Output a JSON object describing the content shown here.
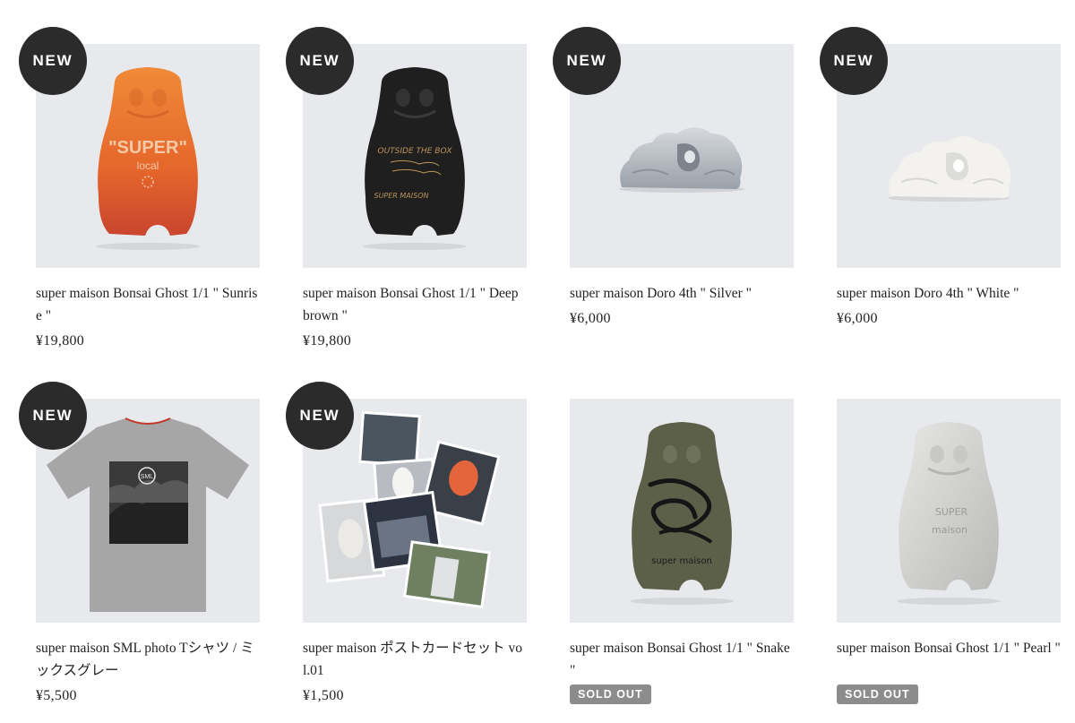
{
  "products": [
    {
      "title": "super maison Bonsai Ghost 1/1 \" Sunrise \"",
      "price": "¥19,800",
      "badge": "NEW",
      "image_icon": "orange-ghost-figure"
    },
    {
      "title": "super maison Bonsai Ghost 1/1 \" Deep brown \"",
      "price": "¥19,800",
      "badge": "NEW",
      "image_icon": "black-ghost-figure"
    },
    {
      "title": "super maison Doro 4th \" Silver \"",
      "price": "¥6,000",
      "badge": "NEW",
      "image_icon": "silver-doro-figure"
    },
    {
      "title": "super maison Doro 4th \" White \"",
      "price": "¥6,000",
      "badge": "NEW",
      "image_icon": "white-doro-figure"
    },
    {
      "title": "super maison SML photo Tシャツ / ミックスグレー",
      "price": "¥5,500",
      "badge": "NEW",
      "image_icon": "grey-tshirt"
    },
    {
      "title": "super maison ポストカードセット vol.01",
      "price": "¥1,500",
      "badge": "NEW",
      "image_icon": "postcard-set"
    },
    {
      "title": "super maison Bonsai Ghost 1/1 \" Snake \"",
      "status": "SOLD OUT",
      "image_icon": "snake-ghost-figure"
    },
    {
      "title": "super maison Bonsai Ghost 1/1 \" Pearl \"",
      "status": "SOLD OUT",
      "image_icon": "pearl-ghost-figure"
    }
  ],
  "figure_text": {
    "sunrise_word1": "\"SUPER\"",
    "sunrise_word2": "local",
    "deep_brown_word1": "OUTSIDE THE BOX",
    "deep_brown_word2": "SUPER MAISON",
    "snake_word": "super maison",
    "pearl_word1": "SUPER",
    "pearl_word2": "maison"
  },
  "colors": {
    "thumb_bg": "#e7e9ec",
    "badge_bg": "#2b2b2b",
    "soldout_bg": "#8c8c8c"
  }
}
